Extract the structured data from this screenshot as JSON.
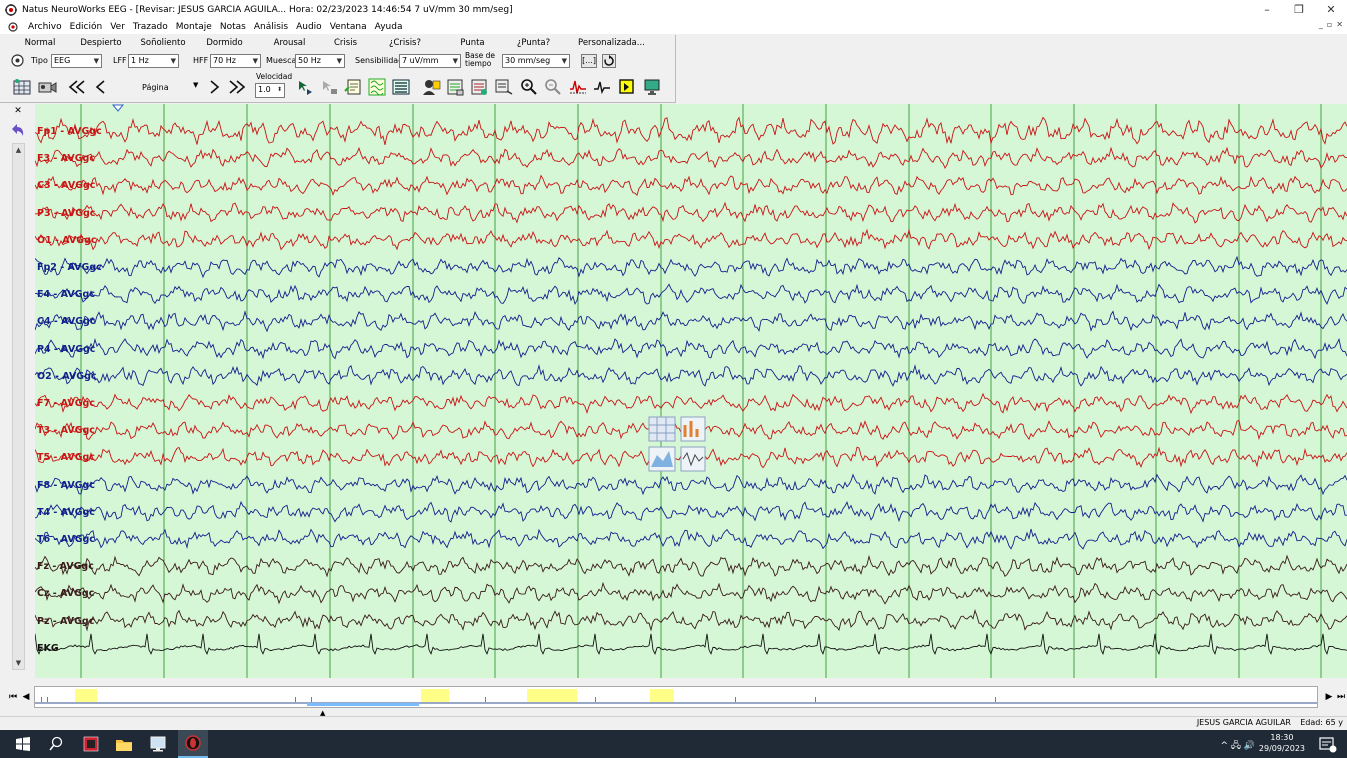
{
  "window": {
    "title": "Natus NeuroWorks EEG - [Revisar:   JESUS  GARCIA AGUILA...  Hora: 02/23/2023 14:46:54   7 uV/mm   30 mm/seg]",
    "minimize": "–",
    "maximize": "❐",
    "close": "✕"
  },
  "menu": {
    "items": [
      "Archivo",
      "Edición",
      "Ver",
      "Trazado",
      "Montaje",
      "Notas",
      "Análisis",
      "Audio",
      "Ventana",
      "Ayuda"
    ],
    "mdi_buttons": [
      "_",
      "▫",
      "✕"
    ]
  },
  "states": [
    "Normal",
    "Despierto",
    "Soñoliento",
    "Dormido",
    "Arousal",
    "Crisis",
    "¿Crisis?",
    "Punta",
    "¿Punta?",
    "Personalizada..."
  ],
  "filters": {
    "tipo_label": "Tipo",
    "tipo_value": "EEG",
    "lff_label": "LFF",
    "lff_value": "1 Hz",
    "hff_label": "HFF",
    "hff_value": "70 Hz",
    "muesca_label": "Muesca",
    "muesca_value": "50 Hz",
    "sensibilidad_label": "Sensibilidad",
    "sensibilidad_value": "7 uV/mm",
    "base_label_1": "Base de",
    "base_label_2": "tiempo",
    "base_value": "30 mm/seg",
    "bracket_btn": "[...]"
  },
  "nav": {
    "page_label": "Página",
    "velocidad_label": "Velocidad",
    "velocidad_value": "1.0"
  },
  "channels": [
    {
      "label": "Fp1 - AVGgc",
      "color": "#c81414"
    },
    {
      "label": "F3 - AVGgc",
      "color": "#c81414"
    },
    {
      "label": "C3 - AVGgc",
      "color": "#c81414"
    },
    {
      "label": "P3 - AVGgc",
      "color": "#c81414"
    },
    {
      "label": "O1 - AVGgc",
      "color": "#c81414"
    },
    {
      "label": "Fp2 - AVGgc",
      "color": "#12208c"
    },
    {
      "label": "F4 - AVGgc",
      "color": "#12208c"
    },
    {
      "label": "C4 - AVGgc",
      "color": "#12208c"
    },
    {
      "label": "P4 - AVGgc",
      "color": "#12208c"
    },
    {
      "label": "O2 - AVGgc",
      "color": "#12208c"
    },
    {
      "label": "F7 - AVGgc",
      "color": "#c81414"
    },
    {
      "label": "T3 - AVGgc",
      "color": "#c81414"
    },
    {
      "label": "T5 - AVGgc",
      "color": "#c81414"
    },
    {
      "label": "F8 - AVGgc",
      "color": "#12208c"
    },
    {
      "label": "T4 - AVGgc",
      "color": "#12208c"
    },
    {
      "label": "T6 - AVGgc",
      "color": "#12208c"
    },
    {
      "label": "Fz - AVGgc",
      "color": "#3a1a1a"
    },
    {
      "label": "Cz - AVGgc",
      "color": "#3a1a1a"
    },
    {
      "label": "Pz - AVGgc",
      "color": "#3a1a1a"
    },
    {
      "label": "EKG",
      "color": "#111111"
    }
  ],
  "status": {
    "patient": "JESUS  GARCIA AGUILAR",
    "age": "Edad: 65 y"
  },
  "clock": {
    "time": "18:30",
    "date": "29/09/2023"
  },
  "colors": {
    "eeg_background": "#d6f7d6",
    "second_gridline": "#1f8a1f",
    "marker_yellow": "#ffff88"
  }
}
